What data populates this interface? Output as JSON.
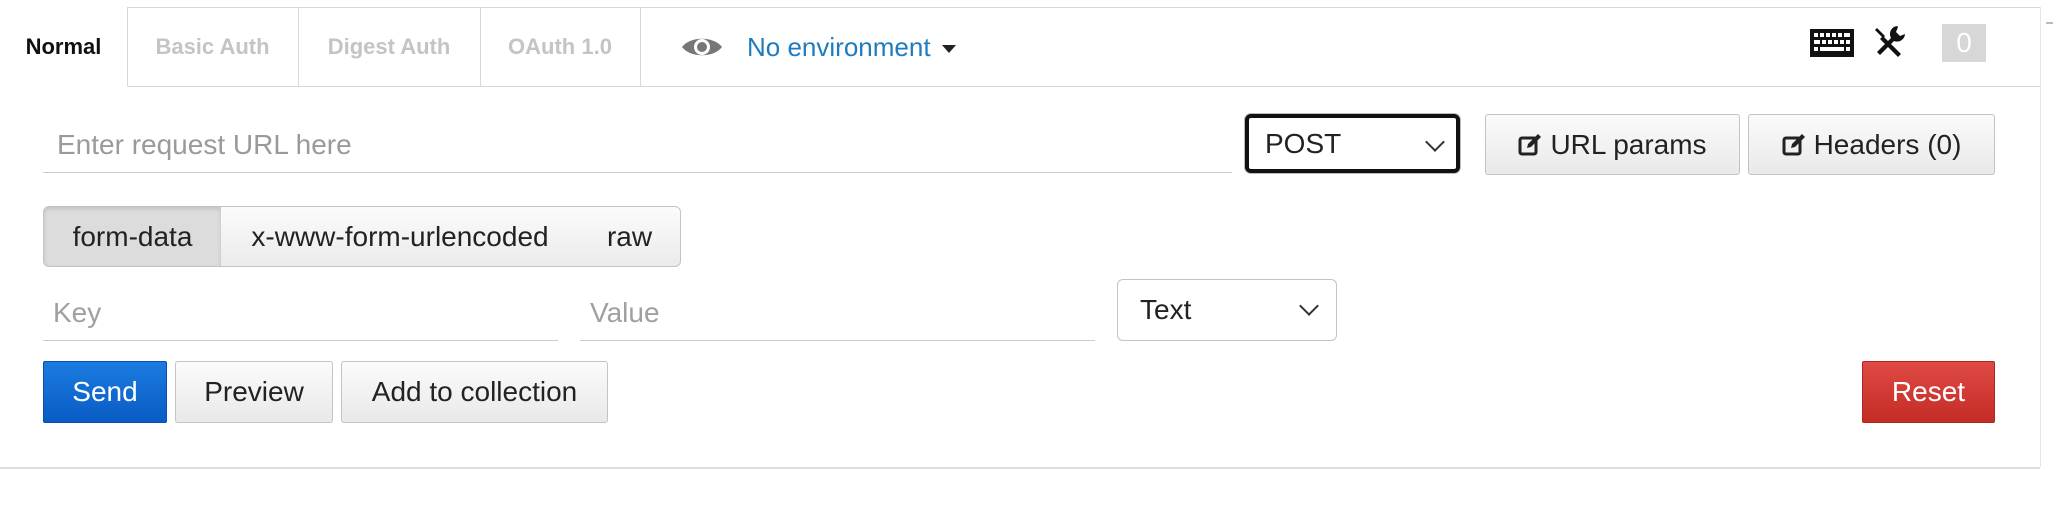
{
  "tabs": [
    {
      "label": "Normal",
      "active": true
    },
    {
      "label": "Basic Auth",
      "active": false
    },
    {
      "label": "Digest Auth",
      "active": false
    },
    {
      "label": "OAuth 1.0",
      "active": false
    }
  ],
  "environment": {
    "label": "No environment",
    "icon": "eye-icon"
  },
  "toolbar": {
    "keyboard_icon": "keyboard-icon",
    "wrench_icon": "wrench-icon",
    "count": "0"
  },
  "request": {
    "url_placeholder": "Enter request URL here",
    "url_value": "",
    "method": "POST",
    "url_params_label": "URL params",
    "headers_label": "Headers (0)"
  },
  "body_modes": [
    {
      "label": "form-data",
      "active": true
    },
    {
      "label": "x-www-form-urlencoded",
      "active": false
    },
    {
      "label": "raw",
      "active": false
    }
  ],
  "form_row": {
    "key_placeholder": "Key",
    "value_placeholder": "Value",
    "type": "Text"
  },
  "actions": {
    "send": "Send",
    "preview": "Preview",
    "add_to_collection": "Add to collection",
    "reset": "Reset"
  },
  "colors": {
    "send_blue": "#0a5cc4",
    "reset_red": "#c42c26",
    "link_blue": "#1f7bc0"
  }
}
